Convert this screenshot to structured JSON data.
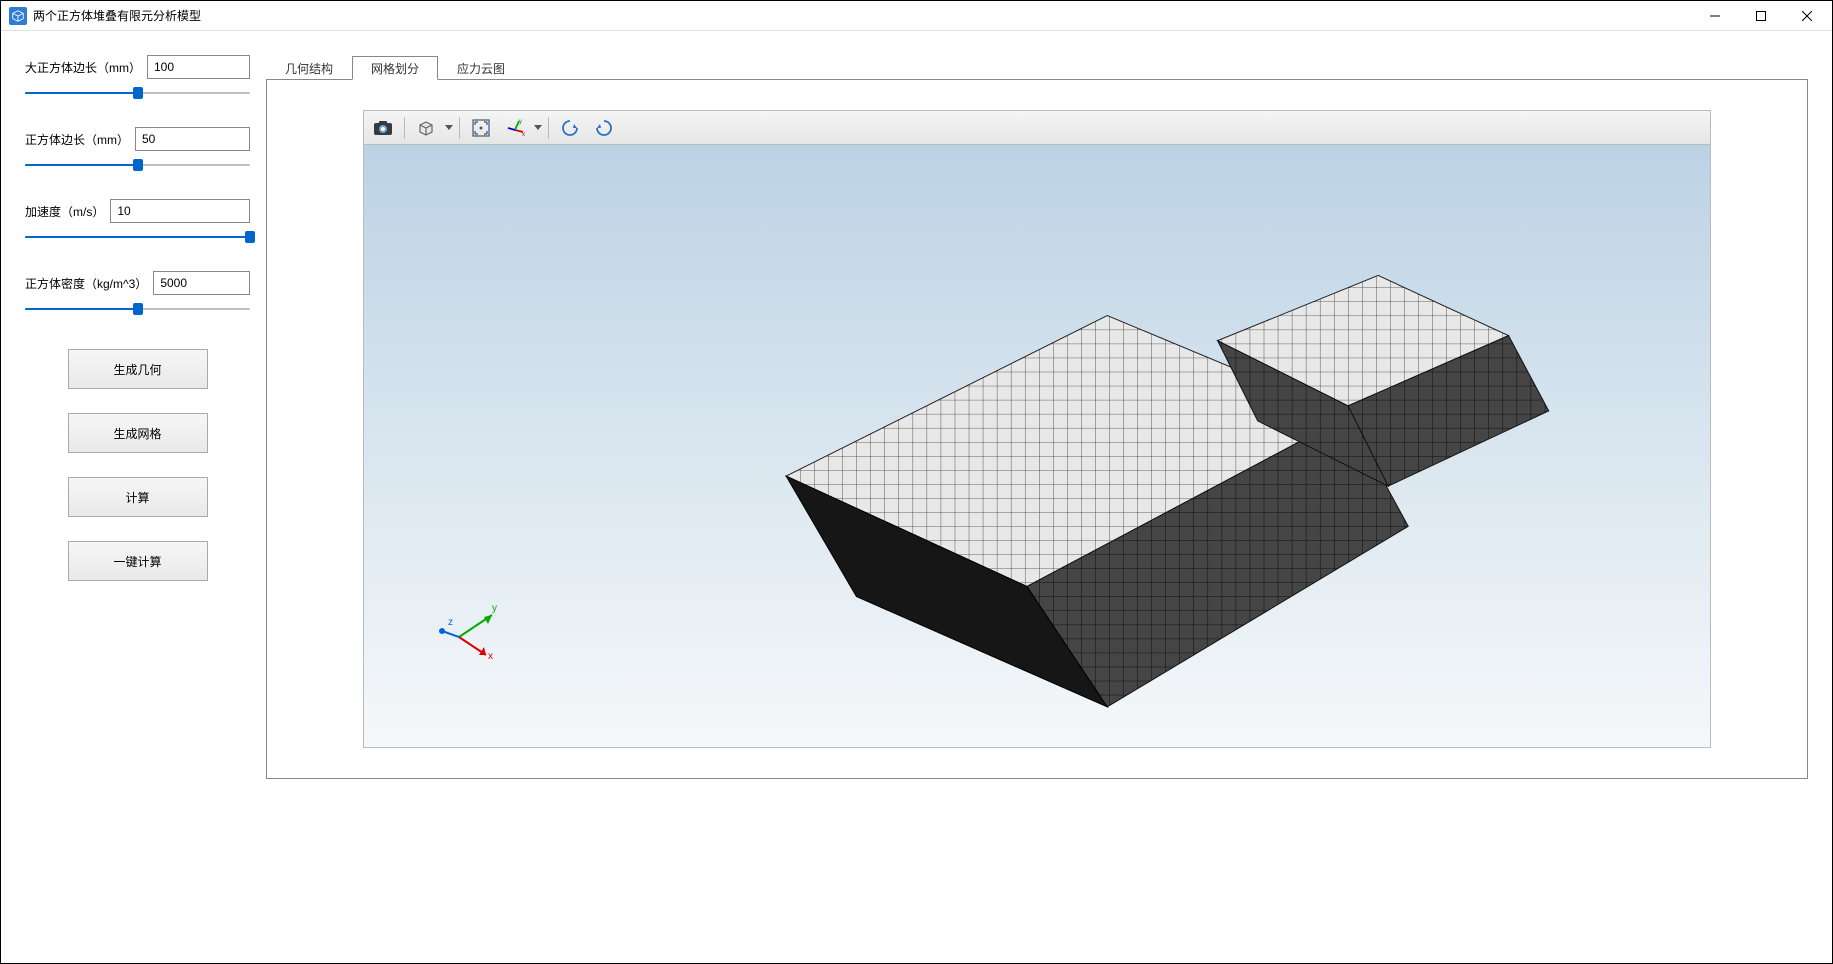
{
  "window": {
    "title": "两个正方体堆叠有限元分析模型"
  },
  "params": {
    "big_cube": {
      "label": "大正方体边长（mm）",
      "value": "100",
      "slider_pct": 50
    },
    "small_cube": {
      "label": "正方体边长（mm）",
      "value": "50",
      "slider_pct": 50
    },
    "accel": {
      "label": "加速度（m/s）",
      "value": "10",
      "slider_pct": 100
    },
    "density": {
      "label": "正方体密度（kg/m^3）",
      "value": "5000",
      "slider_pct": 50
    }
  },
  "buttons": {
    "gen_geom": "生成几何",
    "gen_mesh": "生成网格",
    "compute": "计算",
    "one_click": "一键计算"
  },
  "tabs": {
    "geometry": "几何结构",
    "mesh": "网格划分",
    "stress": "应力云图"
  },
  "triad": {
    "x": "x",
    "y": "y",
    "z": "z"
  }
}
